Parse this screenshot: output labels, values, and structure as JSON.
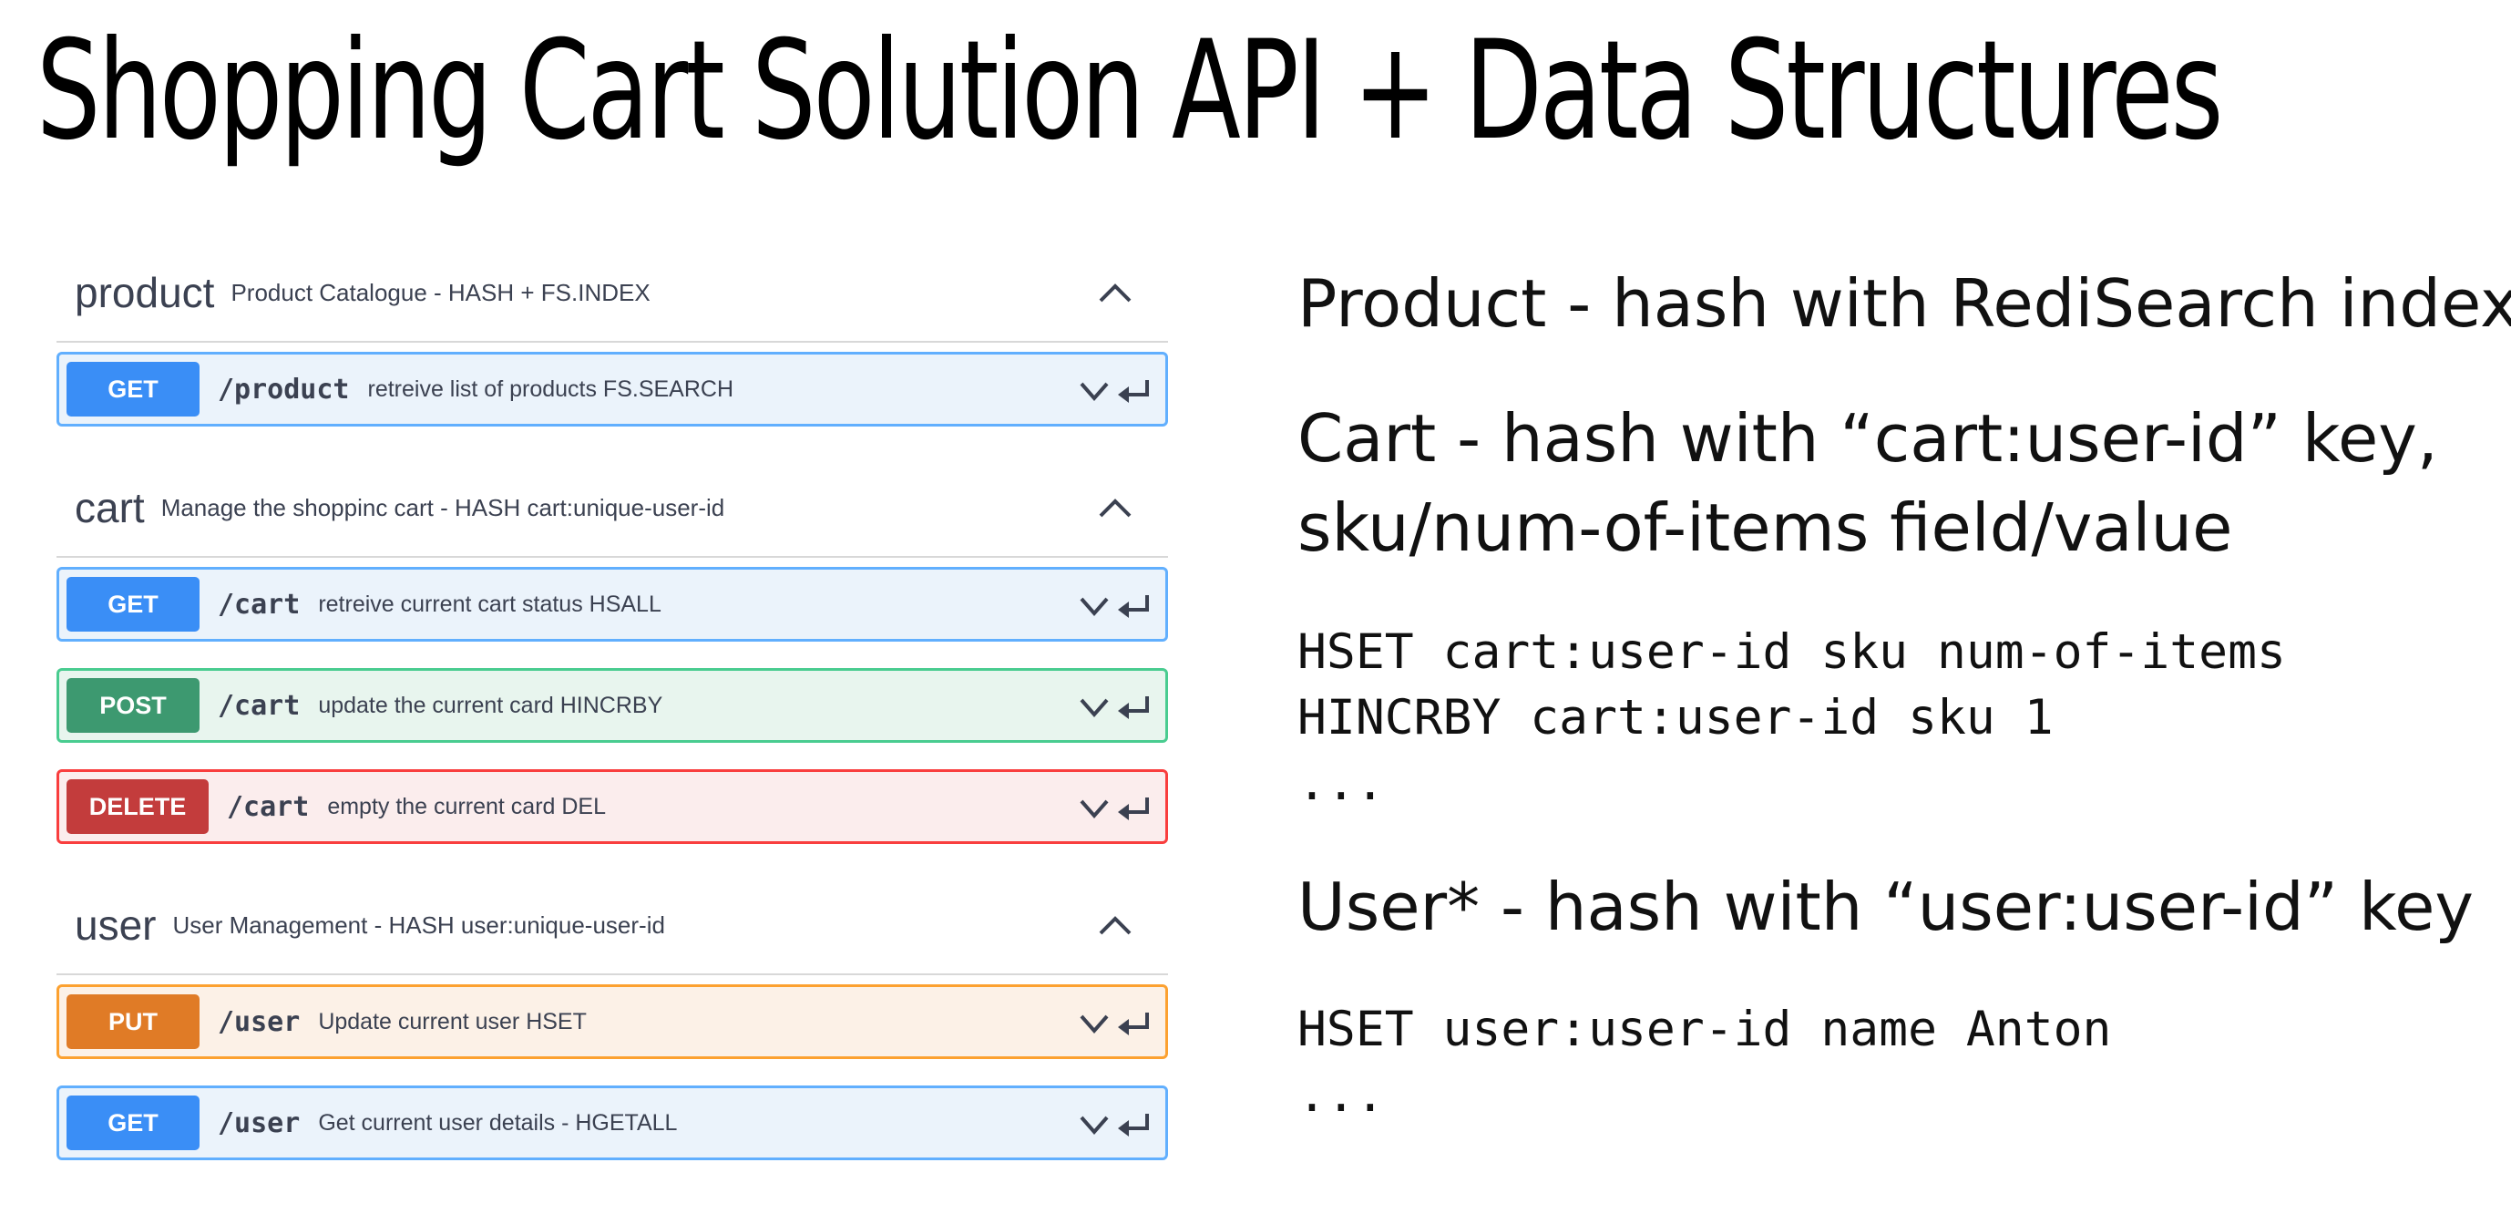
{
  "title": "Shopping Cart Solution API + Data Structures",
  "api": {
    "sections": [
      {
        "name": "product",
        "description": "Product Catalogue - HASH + FS.INDEX",
        "operations": [
          {
            "method": "GET",
            "path": "/product",
            "summary": "retreive list of products FS.SEARCH"
          }
        ]
      },
      {
        "name": "cart",
        "description": "Manage the shoppinc cart - HASH cart:unique-user-id",
        "operations": [
          {
            "method": "GET",
            "path": "/cart",
            "summary": "retreive current cart status HSALL"
          },
          {
            "method": "POST",
            "path": "/cart",
            "summary": "update the current card HINCRBY"
          },
          {
            "method": "DELETE",
            "path": "/cart",
            "summary": "empty the current card DEL"
          }
        ]
      },
      {
        "name": "user",
        "description": "User Management - HASH user:unique-user-id",
        "operations": [
          {
            "method": "PUT",
            "path": "/user",
            "summary": "Update current user HSET"
          },
          {
            "method": "GET",
            "path": "/user",
            "summary": "Get current user details - HGETALL"
          }
        ]
      }
    ]
  },
  "notes": {
    "product_heading": "Product - hash with RediSearch index",
    "cart_heading_line1": "Cart - hash with “cart:user-id” key,",
    "cart_heading_line2": "sku/num-of-items field/value",
    "cart_code": [
      "HSET cart:user-id sku num-of-items",
      "HINCRBY cart:user-id sku 1",
      "..."
    ],
    "user_heading": "User* - hash with “user:user-id” key",
    "user_code": [
      "HSET user:user-id name Anton",
      "..."
    ]
  },
  "colors": {
    "get": "#3a8ef6",
    "post": "#3d9970",
    "delete": "#c33c3c",
    "put": "#e07b26"
  },
  "icons": {
    "section_toggle": "chevron-up-icon",
    "op_expand": "chevron-down-icon",
    "op_try": "return-arrow-icon"
  }
}
